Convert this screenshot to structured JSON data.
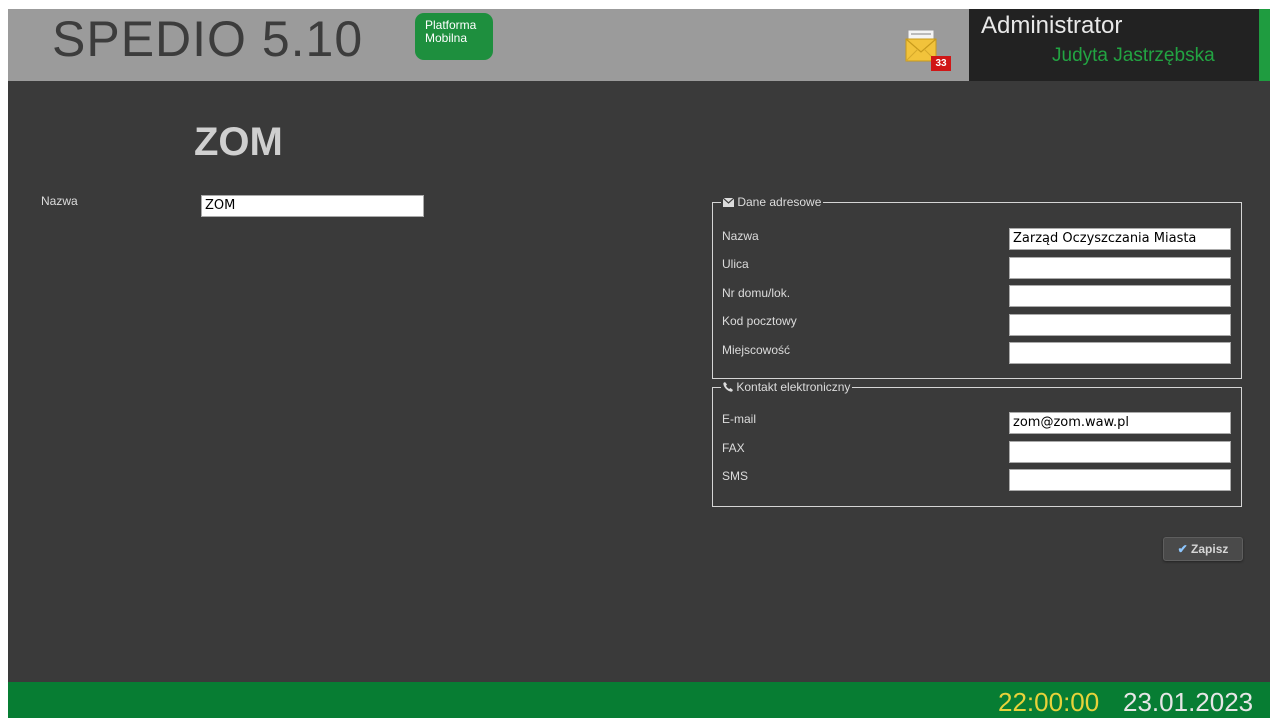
{
  "header": {
    "app_title": "SPEDIO 5.10",
    "badge_line1": "Platforma",
    "badge_line2": "Mobilna",
    "mail_count": "33",
    "user_role": "Administrator",
    "user_name": "Judyta Jastrzębska"
  },
  "page": {
    "title": "ZOM",
    "name_label": "Nazwa",
    "name_value": "ZOM"
  },
  "address": {
    "legend": "Dane adresowe",
    "icon": "envelope-icon",
    "fields": [
      {
        "label": "Nazwa",
        "value": "Zarząd Oczyszczania Miasta"
      },
      {
        "label": "Ulica",
        "value": ""
      },
      {
        "label": "Nr domu/lok.",
        "value": ""
      },
      {
        "label": "Kod pocztowy",
        "value": ""
      },
      {
        "label": "Miejscowość",
        "value": ""
      }
    ]
  },
  "contact": {
    "legend": "Kontakt elektroniczny",
    "icon": "phone-icon",
    "fields": [
      {
        "label": "E-mail",
        "value": "zom@zom.waw.pl"
      },
      {
        "label": "FAX",
        "value": ""
      },
      {
        "label": "SMS",
        "value": ""
      }
    ]
  },
  "actions": {
    "save_label": "Zapisz"
  },
  "footer": {
    "time": "22:00:00",
    "date": "23.01.2023"
  },
  "colors": {
    "accent_green": "#077d33",
    "clock_yellow": "#e7d23a",
    "badge_green": "#1e8f3e",
    "background": "#3a3a3a"
  }
}
